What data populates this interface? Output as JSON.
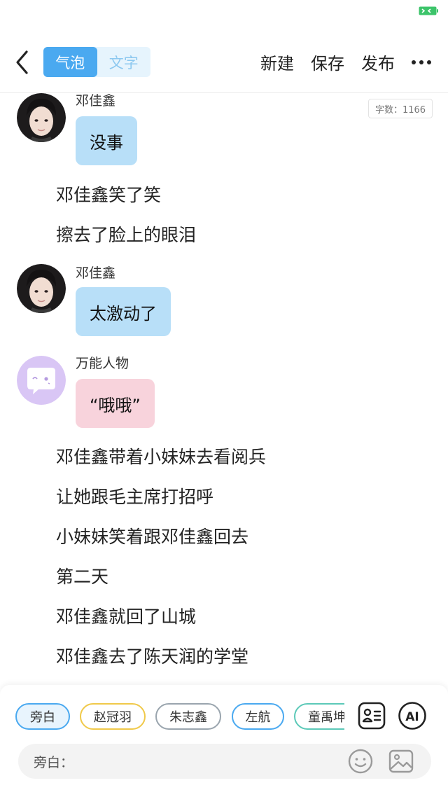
{
  "header": {
    "mode_bubble": "气泡",
    "mode_text": "文字",
    "new_label": "新建",
    "save_label": "保存",
    "publish_label": "发布"
  },
  "word_count": "字数：1166",
  "messages": [
    {
      "speaker": "邓佳鑫",
      "text": "没事"
    },
    {
      "narration": "邓佳鑫笑了笑"
    },
    {
      "narration": "擦去了脸上的眼泪"
    },
    {
      "speaker": "邓佳鑫",
      "text": "太激动了"
    },
    {
      "speaker": "万能人物",
      "text": "“哦哦”"
    },
    {
      "narration": "邓佳鑫带着小妹妹去看阅兵"
    },
    {
      "narration": "让她跟毛主席打招呼"
    },
    {
      "narration": "小妹妹笑着跟邓佳鑫回去"
    },
    {
      "narration": "第二天"
    },
    {
      "narration": "邓佳鑫就回了山城"
    },
    {
      "narration": "邓佳鑫去了陈天润的学堂"
    }
  ],
  "characters": [
    "旁白",
    "赵冠羽",
    "朱志鑫",
    "左航",
    "童禹坤"
  ],
  "character_colors": [
    "#4aa9f0",
    "#f0c94a",
    "#9aa5ae",
    "#4aa9f0",
    "#5cc9b8"
  ],
  "input": {
    "prefix": "旁白：",
    "value": ""
  },
  "icons": [
    "back-icon",
    "battery-icon",
    "more-icon",
    "role-list-icon",
    "ai-icon",
    "emoji-icon",
    "image-icon"
  ],
  "colors": {
    "accent": "#4aa9f0",
    "bubble_blue": "#b8dff8",
    "bubble_pink": "#f8d3dc",
    "battery": "#3cc46a"
  },
  "ai_label": "AI"
}
